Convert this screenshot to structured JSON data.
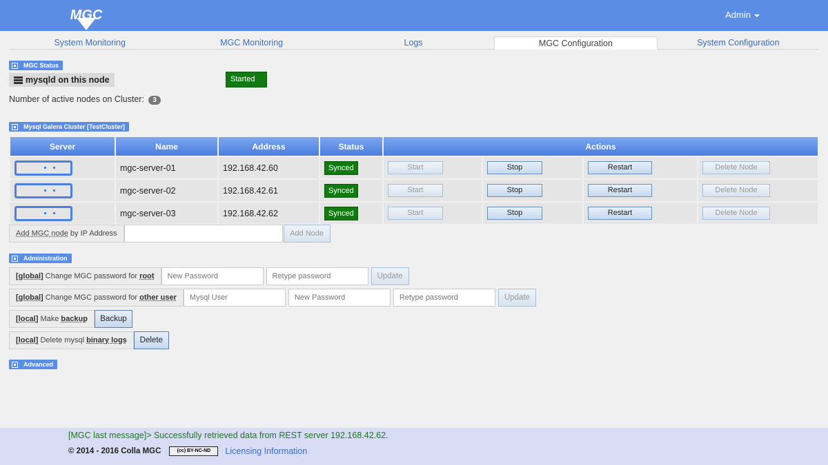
{
  "header": {
    "admin_label": "Admin"
  },
  "tabs": [
    {
      "label": "System Monitoring"
    },
    {
      "label": "MGC Monitoring"
    },
    {
      "label": "Logs"
    },
    {
      "label": "MGC Configuration"
    },
    {
      "label": "System Configuration"
    }
  ],
  "status": {
    "section_title": "MGC Status",
    "node_label": "mysqld on this node",
    "state": "Started",
    "active_nodes_label": "Number of active nodes on Cluster:",
    "active_nodes_count": "3"
  },
  "cluster": {
    "section_title": "Mysql Galera Cluster [TestCluster]",
    "columns": [
      "Server",
      "Name",
      "Address",
      "Status",
      "Actions"
    ],
    "rows": [
      {
        "name": "mgc-server-01",
        "address": "192.168.42.60",
        "status": "Synced"
      },
      {
        "name": "mgc-server-02",
        "address": "192.168.42.61",
        "status": "Synced"
      },
      {
        "name": "mgc-server-03",
        "address": "192.168.42.62",
        "status": "Synced"
      }
    ],
    "actions": {
      "start": "Start",
      "stop": "Stop",
      "restart": "Restart",
      "delete": "Delete Node"
    },
    "add_label_1": "Add MGC node",
    "add_label_2": " by IP Address",
    "add_button": "Add Node"
  },
  "admin": {
    "section_title": "Administration",
    "root_scope": "[global]",
    "root_text": " Change MGC password for ",
    "root_target": "root",
    "other_scope": "[global]",
    "other_text": " Change MGC password for ",
    "other_target": "other user",
    "new_password_placeholder": "New Password",
    "retype_password_placeholder": "Retype password",
    "mysql_user_placeholder": "Mysql User",
    "update_label": "Update",
    "backup_scope": "[local]",
    "backup_text": " Make ",
    "backup_target": "backup",
    "backup_button": "Backup",
    "binlog_scope": "[local]",
    "binlog_text": " Delete mysql ",
    "binlog_target": "binary logs",
    "delete_button": "Delete"
  },
  "advanced": {
    "section_title": "Advanced"
  },
  "footer": {
    "last_message": "[MGC last message]> Successfully retrieved data from REST server 192.168.42.62.",
    "copyright": "© 2014 - 2016 Colla MGC",
    "cc_badge": "(cc) BY-NC-ND",
    "license_link": "Licensing Information"
  },
  "colors": {
    "header_blue": "#5b8de5",
    "synced_green": "#117a11",
    "footer_bg": "#d9dcf5"
  }
}
